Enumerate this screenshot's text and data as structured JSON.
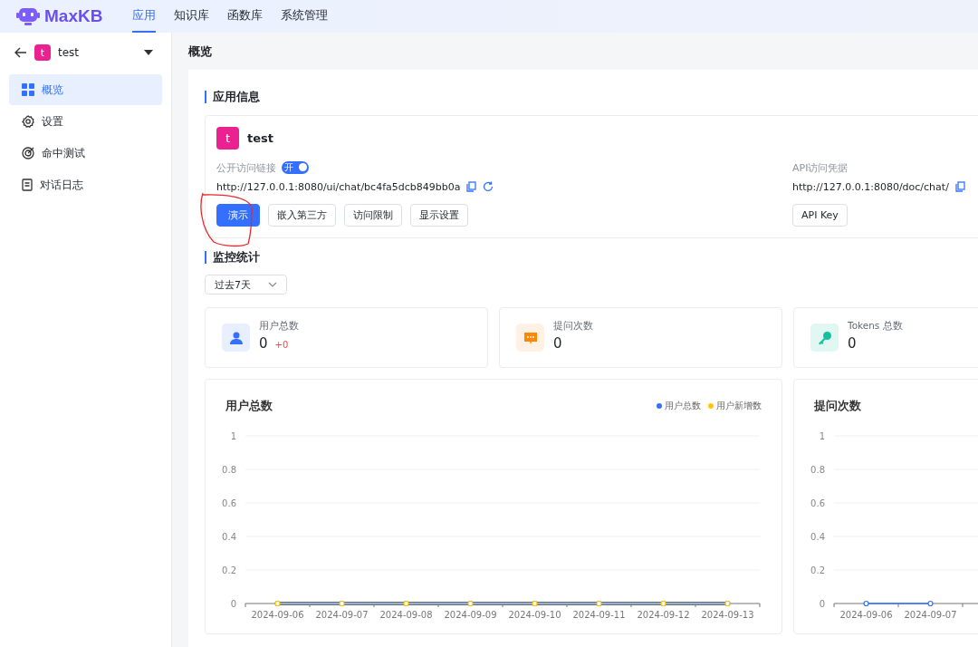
{
  "header": {
    "logo": "MaxKB",
    "nav": [
      {
        "label": "应用",
        "selected": true
      },
      {
        "label": "知识库",
        "selected": false
      },
      {
        "label": "函数库",
        "selected": false
      },
      {
        "label": "系统管理",
        "selected": false
      }
    ]
  },
  "sidebar": {
    "app_avatar": "t",
    "app_name": "test",
    "items": [
      {
        "label": "概览",
        "kind": "grid",
        "selected": true
      },
      {
        "label": "设置",
        "kind": "gear",
        "selected": false
      },
      {
        "label": "命中测试",
        "kind": "target",
        "selected": false
      },
      {
        "label": "对话日志",
        "kind": "doc",
        "selected": false
      }
    ]
  },
  "page_title": "概览",
  "app_info": {
    "heading": "应用信息",
    "avatar": "t",
    "name": "test",
    "public_link_label": "公开访问链接",
    "public_link_switch": {
      "label": "开",
      "on": true
    },
    "public_link": "http://127.0.0.1:8080/ui/chat/bc4fa5dcb849bb0a",
    "buttons": [
      {
        "label": "演示",
        "primary": true
      },
      {
        "label": "嵌入第三方",
        "primary": false
      },
      {
        "label": "访问限制",
        "primary": false
      },
      {
        "label": "显示设置",
        "primary": false
      }
    ],
    "api_label": "API访问凭据",
    "api_link": "http://127.0.0.1:8080/doc/chat/",
    "api_button": "API Key"
  },
  "monitor": {
    "heading": "监控统计",
    "range": "过去7天",
    "stats": [
      {
        "label": "用户总数",
        "value": "0",
        "delta": "+0",
        "kind": "user"
      },
      {
        "label": "提问次数",
        "value": "0",
        "kind": "chat"
      },
      {
        "label": "Tokens 总数",
        "value": "0",
        "kind": "key"
      }
    ],
    "charts": [
      {
        "chart_data": {
          "type": "line",
          "title": "用户总数",
          "categories": [
            "2024-09-06",
            "2024-09-07",
            "2024-09-08",
            "2024-09-09",
            "2024-09-10",
            "2024-09-11",
            "2024-09-12",
            "2024-09-13"
          ],
          "ylim": [
            0,
            1
          ],
          "yticks": [
            0,
            0.2,
            0.4,
            0.6,
            0.8,
            1
          ],
          "grid": true,
          "legend": true,
          "series": [
            {
              "name": "用户总数",
              "color": "#3370ff",
              "marker": "circle",
              "values": [
                0,
                0,
                0,
                0,
                0,
                0,
                0,
                0
              ]
            },
            {
              "name": "用户新增数",
              "color": "#ffc60a",
              "marker": "circle",
              "values": [
                0,
                0,
                0,
                0,
                0,
                0,
                0,
                0
              ]
            }
          ]
        }
      },
      {
        "chart_data": {
          "type": "line",
          "title": "提问次数",
          "categories": [
            "2024-09-06",
            "2024-09-07"
          ],
          "ylim": [
            0,
            1
          ],
          "yticks": [
            0,
            0.2,
            0.4,
            0.6,
            0.8,
            1
          ],
          "grid": true,
          "series": [
            {
              "color": "#3370ff",
              "marker": "circle",
              "values": [
                0,
                0
              ]
            }
          ]
        }
      }
    ]
  }
}
